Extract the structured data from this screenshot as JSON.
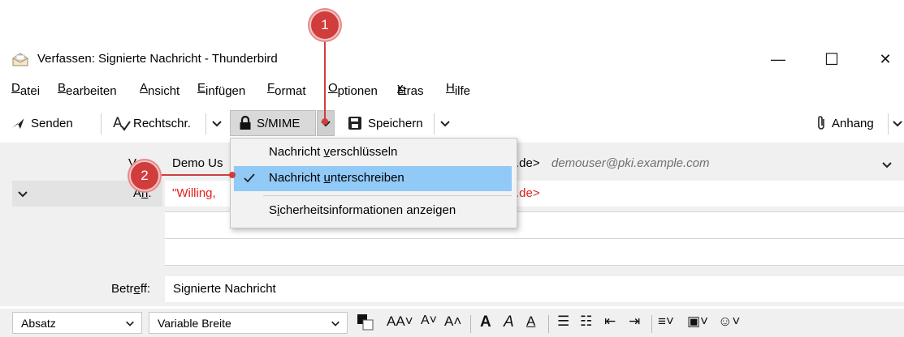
{
  "window": {
    "title": "Verfassen: Signierte Nachricht - Thunderbird",
    "minimize_glyph": "—",
    "maximize_glyph": "☐",
    "close_glyph": "✕"
  },
  "menubar": {
    "items": [
      {
        "pre": "",
        "u": "D",
        "post": "atei"
      },
      {
        "pre": "",
        "u": "B",
        "post": "earbeiten"
      },
      {
        "pre": "",
        "u": "A",
        "post": "nsicht"
      },
      {
        "pre": "",
        "u": "E",
        "post": "infügen"
      },
      {
        "pre": "",
        "u": "F",
        "post": "ormat"
      },
      {
        "pre": "",
        "u": "O",
        "post": "ptionen"
      },
      {
        "pre": "E",
        "u": "x",
        "post": "tras"
      },
      {
        "pre": "",
        "u": "H",
        "post": "ilfe"
      }
    ]
  },
  "toolbar": {
    "send_label": "Senden",
    "spell_label": "Rechtschr.",
    "smime_label": "S/MIME",
    "save_label": "Speichern",
    "attach_label": "Anhang"
  },
  "headers": {
    "from_label_pre": "V",
    "from_label_u": "o",
    "from_label_post": "n:",
    "from_name_partial": "Demo Us",
    "from_addr_suffix": ".de>",
    "from_identity": "demouser@pki.example.com",
    "to_label_pre": "A",
    "to_label_u": "n",
    "to_label_post": ":",
    "to_name_partial": "\"Willing,",
    "to_addr_suffix": ".de>",
    "subject_label_pre": "Betr",
    "subject_label_u": "e",
    "subject_label_post": "ff:",
    "subject_value": "Signierte Nachricht"
  },
  "smime_menu": {
    "items": [
      {
        "pre": "Nachricht ",
        "u": "v",
        "post": "erschlüsseln",
        "checked": false,
        "highlighted": false
      },
      {
        "pre": "Nachricht ",
        "u": "u",
        "post": "nterschreiben",
        "checked": true,
        "highlighted": true
      },
      {
        "pre": "S",
        "u": "i",
        "post": "cherheitsinformationen anzeigen",
        "checked": false,
        "highlighted": false
      }
    ]
  },
  "formatbar": {
    "paragraph_select": "Absatz",
    "font_select": "Variable Breite"
  },
  "callouts": [
    "1",
    "2"
  ],
  "colors": {
    "callout": "#d13d3d",
    "menu_highlight": "#91c9f7",
    "recipient_red": "#e21d1d",
    "header_bg": "#f0f0f0"
  }
}
